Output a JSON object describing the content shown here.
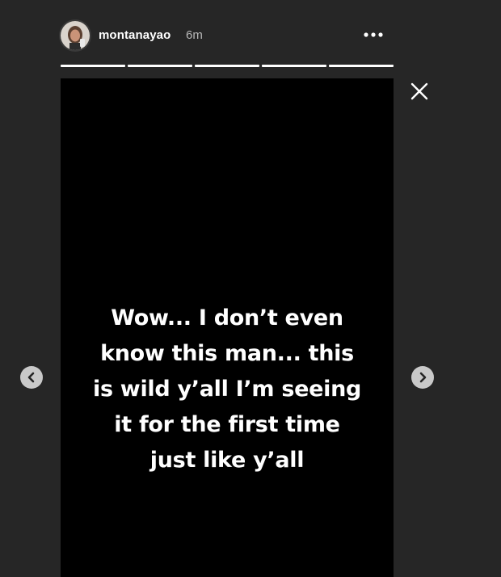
{
  "story": {
    "username": "montanayao",
    "time_ago": "6m",
    "segments": [
      1,
      1,
      1,
      1,
      1
    ],
    "text_lines": [
      "Wow... I don’t even",
      "know this man... this",
      "is wild y’all I’m seeing",
      "it for the first time",
      "just like y’all"
    ]
  },
  "icons": {
    "more": "more-options-icon",
    "close": "close-icon",
    "prev": "chevron-left-icon",
    "next": "chevron-right-icon"
  },
  "colors": {
    "background": "#262626",
    "card": "#000000",
    "text": "#ffffff",
    "muted": "#b8b8b8",
    "nav_button": "#c9c9c9"
  }
}
